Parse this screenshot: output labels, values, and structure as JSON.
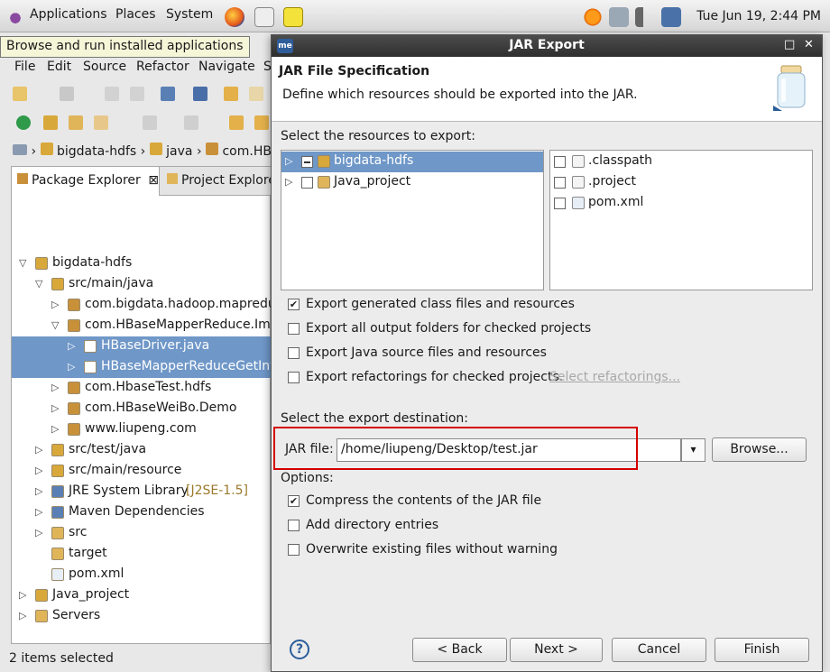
{
  "topbar": {
    "menus": [
      "Applications",
      "Places",
      "System"
    ],
    "clock": "Tue Jun 19,  2:44 PM"
  },
  "tooltip": "Browse and run installed applications",
  "eclipse": {
    "menu": [
      "File",
      "Edit",
      "Source",
      "Refactor",
      "Navigate",
      "S"
    ],
    "breadcrumb": [
      "bigdata-hdfs",
      "java",
      "com.HB"
    ],
    "tabs": [
      "Package Explorer",
      "Project Explore"
    ],
    "tree": [
      {
        "label": "bigdata-hdfs",
        "depth": 0,
        "twisty": "down",
        "icon": "project-icon"
      },
      {
        "label": "src/main/java",
        "depth": 1,
        "twisty": "down",
        "icon": "source-folder-icon"
      },
      {
        "label": "com.bigdata.hadoop.mapreduce",
        "depth": 2,
        "twisty": "right",
        "icon": "package-icon"
      },
      {
        "label": "com.HBaseMapperReduce.Impor",
        "depth": 2,
        "twisty": "down",
        "icon": "package-icon"
      },
      {
        "label": "HBaseDriver.java",
        "depth": 3,
        "twisty": "right",
        "icon": "java-file-icon",
        "selected": true
      },
      {
        "label": "HBaseMapperReduceGetInfo.",
        "depth": 3,
        "twisty": "right",
        "icon": "java-file-icon",
        "selected": true
      },
      {
        "label": "com.HbaseTest.hdfs",
        "depth": 2,
        "twisty": "right",
        "icon": "package-icon"
      },
      {
        "label": "com.HBaseWeiBo.Demo",
        "depth": 2,
        "twisty": "right",
        "icon": "package-icon"
      },
      {
        "label": "www.liupeng.com",
        "depth": 2,
        "twisty": "right",
        "icon": "package-icon"
      },
      {
        "label": "src/test/java",
        "depth": 1,
        "twisty": "right",
        "icon": "source-folder-icon"
      },
      {
        "label": "src/main/resource",
        "depth": 1,
        "twisty": "right",
        "icon": "source-folder-icon"
      },
      {
        "label": "JRE System Library",
        "suffix": "[J2SE-1.5]",
        "depth": 1,
        "twisty": "right",
        "icon": "library-icon"
      },
      {
        "label": "Maven Dependencies",
        "depth": 1,
        "twisty": "right",
        "icon": "library-icon"
      },
      {
        "label": "src",
        "depth": 1,
        "twisty": "right",
        "icon": "folder-icon"
      },
      {
        "label": "target",
        "depth": 1,
        "twisty": "none",
        "icon": "folder-icon"
      },
      {
        "label": "pom.xml",
        "depth": 1,
        "twisty": "none",
        "icon": "xml-file-icon"
      },
      {
        "label": "Java_project",
        "depth": 0,
        "twisty": "right",
        "icon": "project-icon"
      },
      {
        "label": "Servers",
        "depth": 0,
        "twisty": "right",
        "icon": "folder-icon"
      }
    ],
    "status": "2 items selected"
  },
  "dialog": {
    "title": "JAR Export",
    "title_icon": "me",
    "header_title": "JAR File Specification",
    "header_desc": "Define which resources should be exported into the JAR.",
    "resources_label": "Select the resources to export:",
    "left_list": [
      {
        "label": "bigdata-hdfs",
        "state": "partial",
        "selected": true,
        "icon": "project-icon"
      },
      {
        "label": "Java_project",
        "state": "unchecked",
        "selected": false,
        "icon": "folder-icon"
      }
    ],
    "right_list": [
      {
        "label": ".classpath",
        "icon": "x-file-icon"
      },
      {
        "label": ".project",
        "icon": "x-file-icon"
      },
      {
        "label": "pom.xml",
        "icon": "xml-file-icon"
      }
    ],
    "export_options": [
      {
        "label": "Export generated class files and resources",
        "checked": true
      },
      {
        "label": "Export all output folders for checked projects",
        "checked": false
      },
      {
        "label": "Export Java source files and resources",
        "checked": false
      },
      {
        "label": "Export refactorings for checked projects.",
        "checked": false,
        "link": "Select refactorings..."
      }
    ],
    "destination_label": "Select the export destination:",
    "jar_label": "JAR file:",
    "jar_value": "/home/liupeng/Desktop/test.jar",
    "browse_label": "Browse...",
    "options_label": "Options:",
    "jar_options": [
      {
        "label": "Compress the contents of the JAR file",
        "checked": true
      },
      {
        "label": "Add directory entries",
        "checked": false
      },
      {
        "label": "Overwrite existing files without warning",
        "checked": false
      }
    ],
    "buttons": {
      "back": "< Back",
      "next": "Next >",
      "cancel": "Cancel",
      "finish": "Finish"
    },
    "help": "?"
  },
  "colors": {
    "selection": "#6f97c8",
    "highlight_box": "#d40000",
    "title_bar": "#3a3a3a"
  }
}
